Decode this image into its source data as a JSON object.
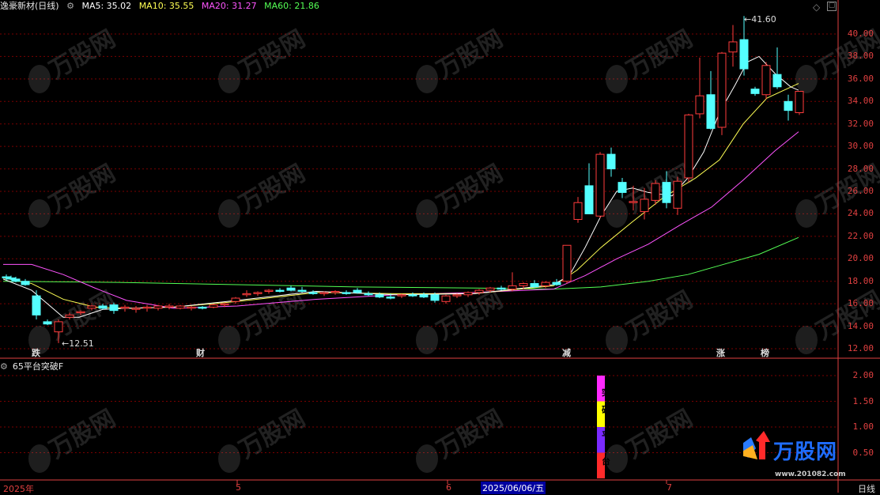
{
  "title": {
    "stock": "逸豪新材",
    "period": "(日线)",
    "ma5": "MA5: 35.02",
    "ma10": "MA10: 35.55",
    "ma20": "MA20: 31.27",
    "ma60": "MA60: 21.86"
  },
  "colors": {
    "up": "#ff3c3c",
    "down": "#54ffff",
    "ma5": "#ffffff",
    "ma10": "#ffff54",
    "ma20": "#ff54ff",
    "ma60": "#54ff54",
    "grid": "#7a0000",
    "axis": "#e04040"
  },
  "price_axis": [
    "40.00",
    "38.00",
    "36.00",
    "34.00",
    "32.00",
    "30.00",
    "28.00",
    "26.00",
    "24.00",
    "22.00",
    "20.00",
    "18.00",
    "16.00",
    "14.00",
    "12.00"
  ],
  "indicator_axis": [
    "2.00",
    "1.50",
    "1.00",
    "0.50"
  ],
  "indicator": {
    "title": "65平台突破F",
    "chars": [
      "突",
      "破",
      "平",
      "台"
    ],
    "value": 2.0
  },
  "annotations": {
    "high": "41.60",
    "low": "12.51"
  },
  "tags": [
    {
      "text": "跌",
      "color": "#54ff54"
    },
    {
      "text": "财",
      "color": "#54ffff"
    },
    {
      "text": "减",
      "color": "#54ff54"
    },
    {
      "text": "涨",
      "color": "#ff3c3c"
    },
    {
      "text": "榜",
      "color": "#ff3c3c"
    }
  ],
  "date_axis": [
    "2025年",
    "5",
    "6",
    "2025/06/06/五",
    "7"
  ],
  "period_label": "日线",
  "watermark": "万股网",
  "watermark_url": "www.201082.com"
}
